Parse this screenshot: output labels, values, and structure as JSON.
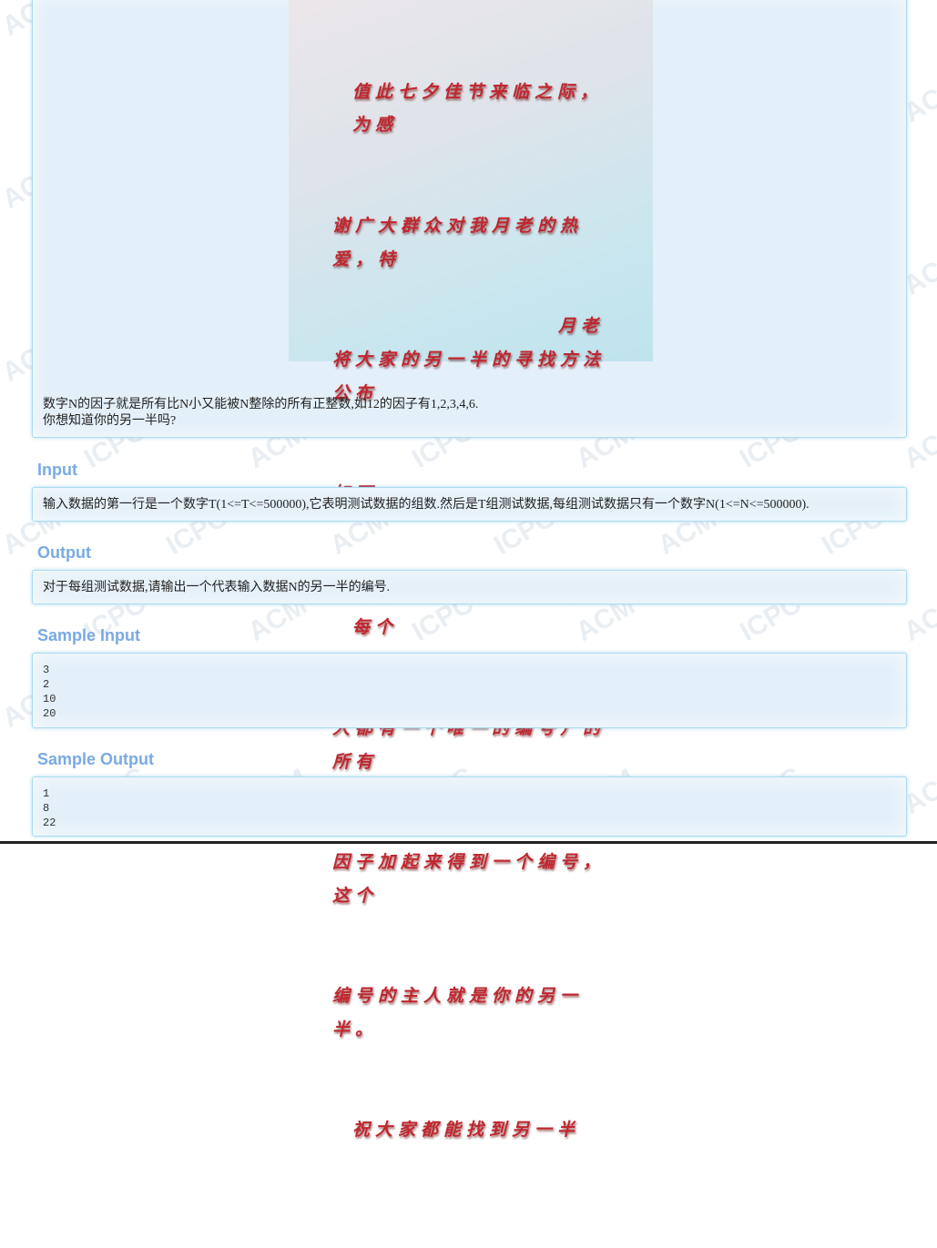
{
  "colors": {
    "heading": "#7aaae3",
    "panel_bg": "#e4f0f9",
    "panel_border": "#a9dcef",
    "poem_text": "#c0262e"
  },
  "watermark": [
    "ACM",
    "ICPC"
  ],
  "poster": {
    "lines": [
      "值此七夕佳节来临之际，为感",
      "谢广大群众对我月老的热爱，特",
      "将大家的另一半的寻找方法公布",
      "如下：",
      "将你的编号（数字王国的每个",
      "人都有一个唯一的编号）的所有",
      "因子加起来得到一个编号，这个",
      "编号的主人就是你的另一半。",
      "祝大家都能找到另一半"
    ],
    "signature": "月老"
  },
  "description": {
    "line1": "数字N的因子就是所有比N小又能被N整除的所有正整数,如12的因子有1,2,3,4,6.",
    "line2": "你想知道你的另一半吗?"
  },
  "input": {
    "heading": "Input",
    "text": "输入数据的第一行是一个数字T(1<=T<=500000),它表明测试数据的组数.然后是T组测试数据,每组测试数据只有一个数字N(1<=N<=500000)."
  },
  "output": {
    "heading": "Output",
    "text": "对于每组测试数据,请输出一个代表输入数据N的另一半的编号."
  },
  "sample_input": {
    "heading": "Sample Input",
    "text": "3\n2\n10\n20"
  },
  "sample_output": {
    "heading": "Sample Output",
    "text": "1\n8\n22"
  }
}
